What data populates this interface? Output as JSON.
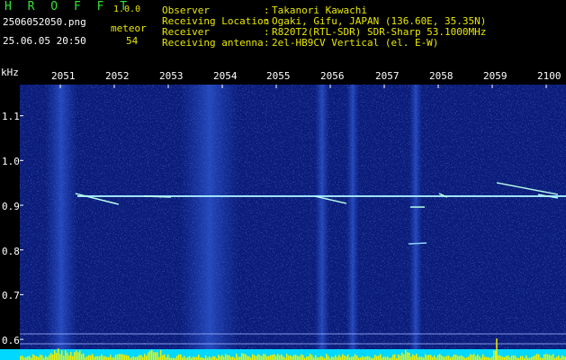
{
  "header": {
    "app_title": "H R O F F T",
    "version": "1.0.0",
    "filename": "2506052050.png",
    "datetime": "25.06.05 20:50",
    "count_label": "meteor",
    "count_value": "54",
    "fields": [
      {
        "label": "Observer",
        "value": "Takanori Kawachi"
      },
      {
        "label": "Receiving Location",
        "value": "Ogaki, Gifu, JAPAN (136.60E, 35.35N)"
      },
      {
        "label": "Receiver",
        "value": "R820T2(RTL-SDR) SDR-Sharp 53.1000MHz"
      },
      {
        "label": "Receiving antenna",
        "value": "2el-HB9CV Vertical (el. E-W)"
      }
    ]
  },
  "axis": {
    "unit": "kHz",
    "time_ticks": [
      "2051",
      "2052",
      "2053",
      "2054",
      "2055",
      "2056",
      "2057",
      "2058",
      "2059",
      "2100"
    ],
    "freq_ticks": [
      "1.1",
      "1.0",
      "0.9",
      "0.8",
      "0.7",
      "0.6"
    ]
  },
  "colors": {
    "background": "#000000",
    "spectrogram_base": "#0a1b7a",
    "carrier_line": "#9fe0ff",
    "label_yellow": "#e8e800",
    "title_green": "#34e334",
    "bottom_bars": "#f0f000",
    "bottom_base": "#00d8ff"
  }
}
